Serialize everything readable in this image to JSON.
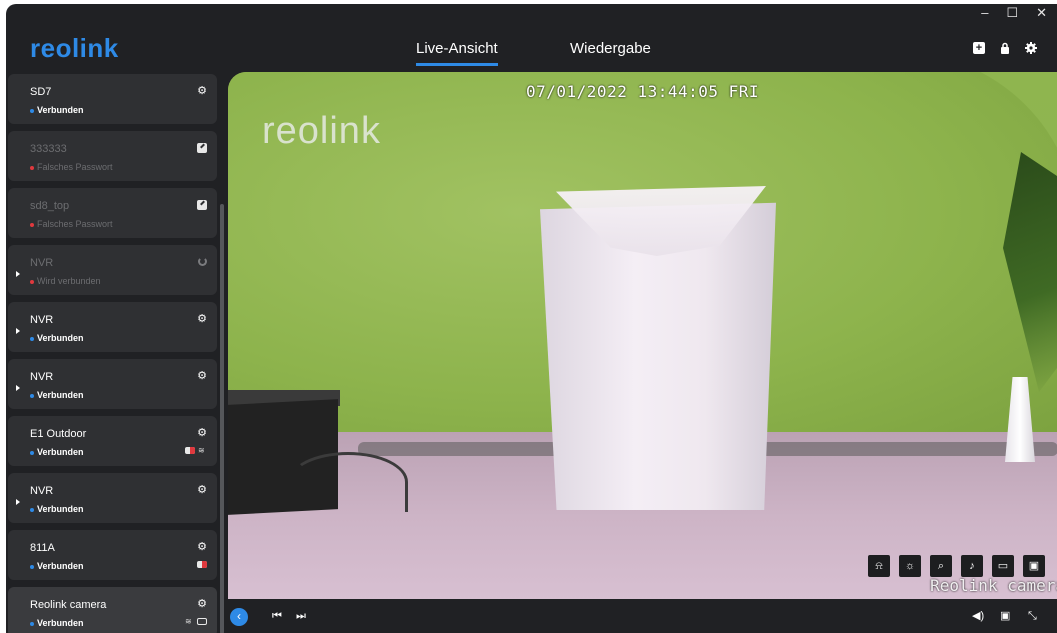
{
  "window": {
    "minimize": "–",
    "maximize": "☐",
    "close": "✕"
  },
  "header": {
    "logo": "reolink",
    "tabs": [
      {
        "label": "Live-Ansicht",
        "active": true
      },
      {
        "label": "Wiedergabe",
        "active": false
      }
    ],
    "icons": [
      "add-icon",
      "lock-icon",
      "settings-icon"
    ],
    "accent": "#2e8ae6"
  },
  "sidebar": {
    "devices": [
      {
        "name": "SD7",
        "status": "Verbunden",
        "state": "connected",
        "action": "gear"
      },
      {
        "name": "333333",
        "status": "Falsches Passwort",
        "state": "error",
        "action": "edit"
      },
      {
        "name": "sd8_top",
        "status": "Falsches Passwort",
        "state": "error",
        "action": "edit"
      },
      {
        "name": "NVR",
        "status": "Wird verbunden",
        "state": "connecting",
        "action": "spinner",
        "expandable": true
      },
      {
        "name": "NVR",
        "status": "Verbunden",
        "state": "connected",
        "action": "gear",
        "expandable": true
      },
      {
        "name": "NVR",
        "status": "Verbunden",
        "state": "connected",
        "action": "gear",
        "expandable": true
      },
      {
        "name": "E1 Outdoor",
        "status": "Verbunden",
        "state": "connected",
        "action": "gear"
      },
      {
        "name": "NVR",
        "status": "Verbunden",
        "state": "connected",
        "action": "gear",
        "expandable": true
      },
      {
        "name": "811A",
        "status": "Verbunden",
        "state": "connected",
        "action": "gear"
      },
      {
        "name": "Reolink camera",
        "status": "Verbunden",
        "state": "connected",
        "action": "gear"
      }
    ]
  },
  "video": {
    "timestamp": "07/01/2022 13:44:05 FRI",
    "watermark": "reolink",
    "camera_name": "Reolink camera",
    "tools": [
      "siren-icon",
      "spotlight-icon",
      "zoom-icon",
      "talk-icon",
      "record-icon",
      "snapshot-icon"
    ]
  },
  "bottombar": {
    "collapse": "‹",
    "prev": "⏮",
    "next": "⏭",
    "volume": "volume-icon",
    "layout": "layout-icon",
    "fullscreen": "fullscreen-icon"
  }
}
